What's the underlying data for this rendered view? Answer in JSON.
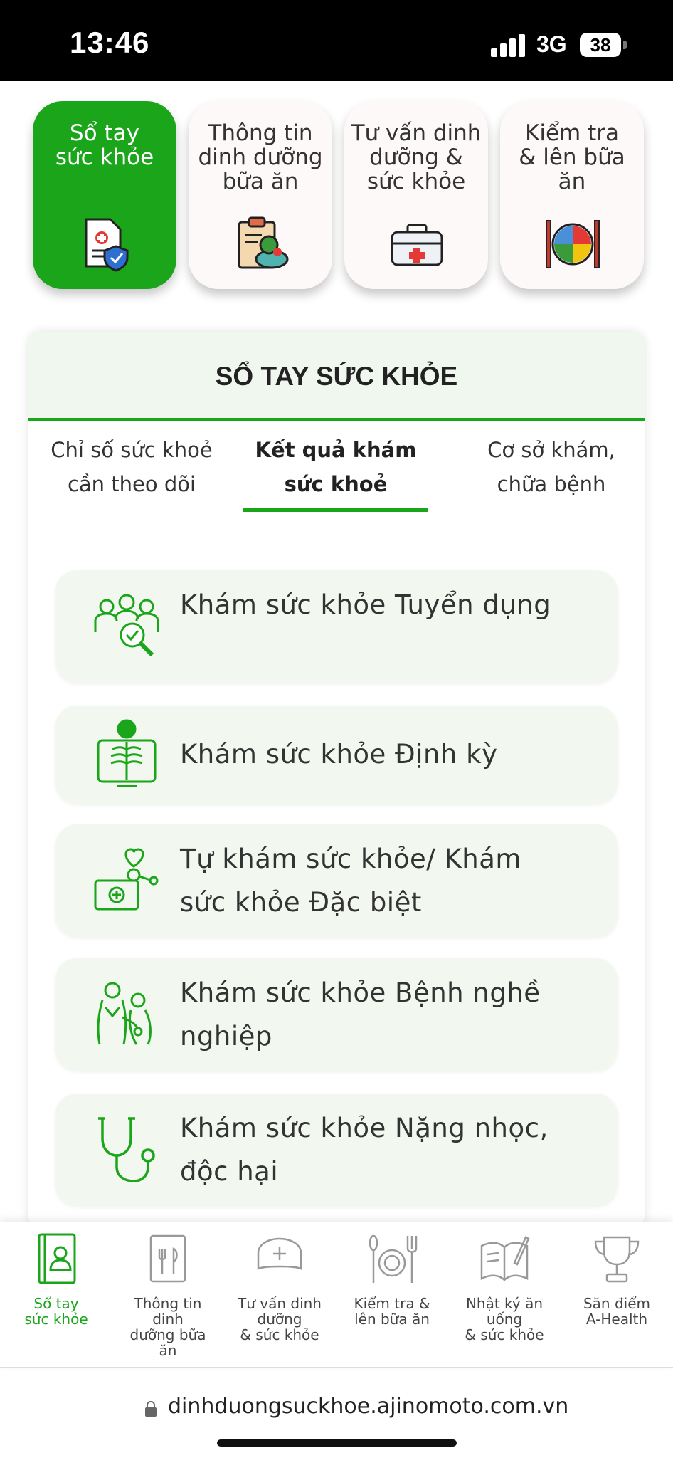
{
  "status_bar": {
    "time": "13:46",
    "network": "3G",
    "battery": "38"
  },
  "top_tabs": [
    {
      "label": "Sổ tay\nsức khỏe",
      "icon": "health-record-icon",
      "active": true
    },
    {
      "label": "Thông tin\ndinh dưỡng\nbữa ăn",
      "icon": "clipboard-meal-icon",
      "active": false
    },
    {
      "label": "Tư vấn dinh\ndưỡng &\nsức khỏe",
      "icon": "first-aid-kit-icon",
      "active": false
    },
    {
      "label": "Kiểm tra\n& lên bữa\năn",
      "icon": "plate-check-icon",
      "active": false
    }
  ],
  "panel": {
    "title": "SỔ TAY SỨC KHỎE",
    "tabs": [
      {
        "label": "Chỉ số sức khoẻ\ncần theo dõi",
        "active": false
      },
      {
        "label": "Kết quả khám\nsức khoẻ",
        "active": true
      },
      {
        "label": "Cơ sở khám,\nchữa bệnh",
        "active": false
      }
    ],
    "items": [
      {
        "label": "Khám sức khỏe Tuyển dụng",
        "icon": "recruitment-checkup-icon"
      },
      {
        "label": "Khám sức khỏe Định kỳ",
        "icon": "xray-icon"
      },
      {
        "label": "Tự khám sức khỏe/ Khám sức khỏe Đặc biệt",
        "icon": "medical-kit-heart-icon"
      },
      {
        "label": "Khám sức khỏe Bệnh nghề nghiệp",
        "icon": "doctor-patient-icon"
      },
      {
        "label": "Khám sức khỏe Nặng nhọc, độc hại",
        "icon": "stethoscope-icon"
      }
    ]
  },
  "bottom_nav": [
    {
      "label": "Sổ tay\nsức khỏe",
      "icon": "health-book-icon",
      "active": true
    },
    {
      "label": "Thông tin\ndinh\ndưỡng bữa\năn",
      "icon": "menu-cutlery-icon",
      "active": false
    },
    {
      "label": "Tư vấn dinh\ndưỡng\n& sức khỏe",
      "icon": "nurse-cap-icon",
      "active": false
    },
    {
      "label": "Kiểm tra &\nlên bữa ăn",
      "icon": "plate-fork-icon",
      "active": false
    },
    {
      "label": "Nhật ký ăn\nuống\n& sức khỏe",
      "icon": "diary-book-icon",
      "active": false
    },
    {
      "label": "Săn điểm\nA-Health",
      "icon": "trophy-icon",
      "active": false
    }
  ],
  "url_bar": {
    "url": "dinhduongsuckhoe.ajinomoto.com.vn"
  },
  "colors": {
    "accent": "#1aa51a",
    "card_bg": "#f2f8ef",
    "header_bg": "#f0f7ee"
  }
}
